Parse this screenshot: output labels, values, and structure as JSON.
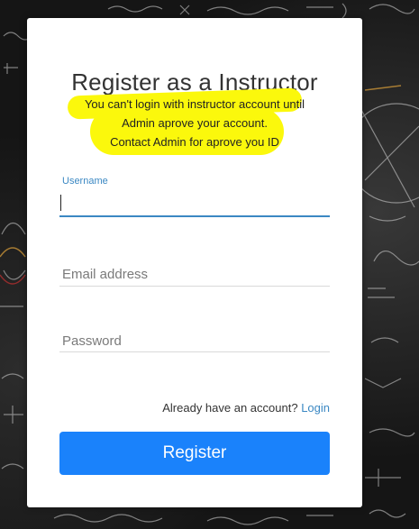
{
  "form": {
    "title": "Register as a Instructor",
    "notice_lines": [
      "You can't login with instructor account until",
      "Admin aprove your account.",
      "Contact Admin for aprove you ID"
    ],
    "username_label": "Username",
    "username_value": "",
    "email_placeholder": "Email address",
    "password_placeholder": "Password",
    "login_prompt": "Already have an account?",
    "login_link": "Login",
    "register_button": "Register"
  },
  "colors": {
    "accent": "#1a82fb",
    "link": "#3b88c3",
    "highlight": "#fbf80c"
  }
}
